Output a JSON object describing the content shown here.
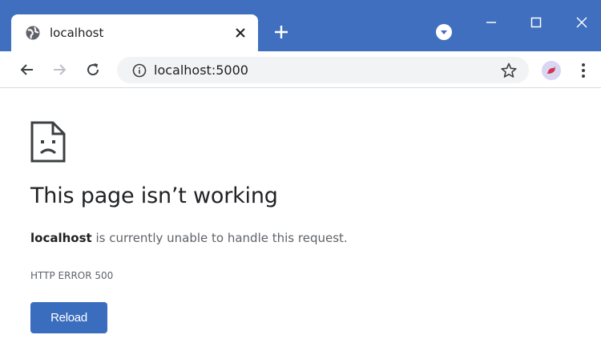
{
  "window": {
    "tab_title": "localhost",
    "accent_color": "#3f6fbe"
  },
  "toolbar": {
    "url": "localhost:5000"
  },
  "error": {
    "title": "This page isn’t working",
    "host": "localhost",
    "message": " is currently unable to handle this request.",
    "code": "HTTP ERROR 500",
    "reload_label": "Reload"
  },
  "icons": {
    "tab_favicon": "globe-icon",
    "tab_close": "close-icon",
    "new_tab": "plus-icon",
    "profile_dropdown": "chevron-down-icon",
    "minimize": "minimize-icon",
    "maximize": "maximize-icon",
    "close": "close-icon",
    "back": "arrow-left-icon",
    "forward": "arrow-right-icon",
    "reload": "reload-icon",
    "site_info": "info-icon",
    "bookmark": "star-icon",
    "menu": "more-vert-icon",
    "error_page": "sad-page-icon"
  }
}
